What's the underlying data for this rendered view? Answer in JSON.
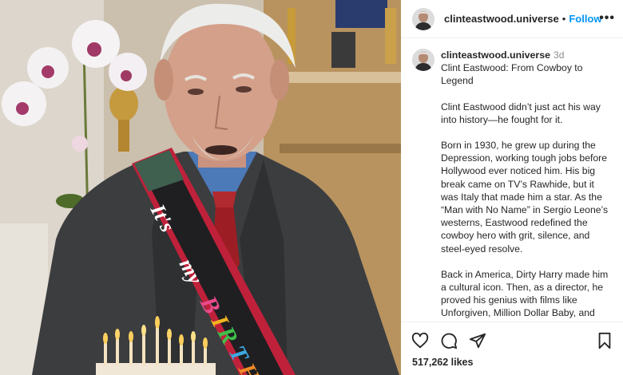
{
  "post": {
    "username": "clinteastwood.universe",
    "follow_label": "Follow",
    "more_label": "•••",
    "time": "3d",
    "caption_title": "Clint Eastwood: From Cowboy to Legend",
    "paragraphs": [
      "Clint Eastwood didn’t just act his way into history—he fought for it.",
      "Born in 1930, he grew up during the Depression, working tough jobs before Hollywood ever noticed him. His big break came on TV’s Rawhide, but it was Italy that made him a star. As the “Man with No Name” in Sergio Leone’s westerns, Eastwood redefined the cowboy hero with grit, silence, and steel-eyed resolve.",
      "Back in America, Dirty Harry made him a cultural icon. Then, as a director, he proved his genius with films like Unforgiven, Million Dollar Baby, and Gran Torino."
    ],
    "likes": "517,262 likes"
  },
  "photo": {
    "sash_text": "It's my BIRTHDAY",
    "sash_segments": [
      "It's",
      "my",
      "B",
      "I",
      "R",
      "T",
      "H"
    ]
  },
  "icons": {
    "like": "heart-icon",
    "comment": "comment-icon",
    "share": "send-icon",
    "save": "bookmark-icon",
    "more": "more-icon"
  },
  "colors": {
    "follow": "#0095f6",
    "text": "#262626",
    "muted": "#8e8e8e"
  }
}
